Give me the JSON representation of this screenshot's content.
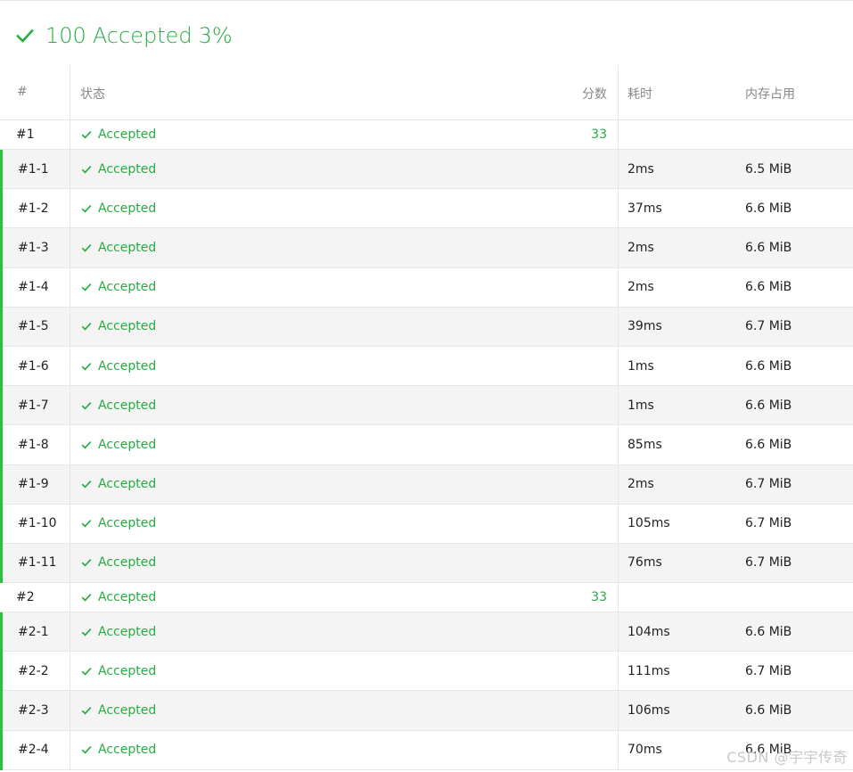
{
  "verdict": {
    "score": "100",
    "status": "Accepted",
    "percent": "3%",
    "icon": "check-icon",
    "color": "#25ad40"
  },
  "table": {
    "headers": {
      "id": "#",
      "status": "状态",
      "score": "分数",
      "time": "耗时",
      "memory": "内存占用"
    },
    "rows": [
      {
        "type": "group",
        "id": "#1",
        "status": "Accepted",
        "score": "33",
        "time": "",
        "memory": ""
      },
      {
        "type": "sub",
        "id": "#1-1",
        "status": "Accepted",
        "score": "",
        "time": "2ms",
        "memory": "6.5 MiB"
      },
      {
        "type": "sub",
        "id": "#1-2",
        "status": "Accepted",
        "score": "",
        "time": "37ms",
        "memory": "6.6 MiB"
      },
      {
        "type": "sub",
        "id": "#1-3",
        "status": "Accepted",
        "score": "",
        "time": "2ms",
        "memory": "6.6 MiB"
      },
      {
        "type": "sub",
        "id": "#1-4",
        "status": "Accepted",
        "score": "",
        "time": "2ms",
        "memory": "6.6 MiB"
      },
      {
        "type": "sub",
        "id": "#1-5",
        "status": "Accepted",
        "score": "",
        "time": "39ms",
        "memory": "6.7 MiB"
      },
      {
        "type": "sub",
        "id": "#1-6",
        "status": "Accepted",
        "score": "",
        "time": "1ms",
        "memory": "6.6 MiB"
      },
      {
        "type": "sub",
        "id": "#1-7",
        "status": "Accepted",
        "score": "",
        "time": "1ms",
        "memory": "6.6 MiB"
      },
      {
        "type": "sub",
        "id": "#1-8",
        "status": "Accepted",
        "score": "",
        "time": "85ms",
        "memory": "6.6 MiB"
      },
      {
        "type": "sub",
        "id": "#1-9",
        "status": "Accepted",
        "score": "",
        "time": "2ms",
        "memory": "6.7 MiB"
      },
      {
        "type": "sub",
        "id": "#1-10",
        "status": "Accepted",
        "score": "",
        "time": "105ms",
        "memory": "6.7 MiB"
      },
      {
        "type": "sub",
        "id": "#1-11",
        "status": "Accepted",
        "score": "",
        "time": "76ms",
        "memory": "6.7 MiB"
      },
      {
        "type": "group",
        "id": "#2",
        "status": "Accepted",
        "score": "33",
        "time": "",
        "memory": ""
      },
      {
        "type": "sub",
        "id": "#2-1",
        "status": "Accepted",
        "score": "",
        "time": "104ms",
        "memory": "6.6 MiB"
      },
      {
        "type": "sub",
        "id": "#2-2",
        "status": "Accepted",
        "score": "",
        "time": "111ms",
        "memory": "6.7 MiB"
      },
      {
        "type": "sub",
        "id": "#2-3",
        "status": "Accepted",
        "score": "",
        "time": "106ms",
        "memory": "6.6 MiB"
      },
      {
        "type": "sub",
        "id": "#2-4",
        "status": "Accepted",
        "score": "",
        "time": "70ms",
        "memory": "6.6 MiB"
      }
    ]
  },
  "watermark": "CSDN @宇宇传奇",
  "colors": {
    "accepted": "#25ad40",
    "subtask_bar": "#25c43f",
    "stripe": "#f4f4f4"
  }
}
